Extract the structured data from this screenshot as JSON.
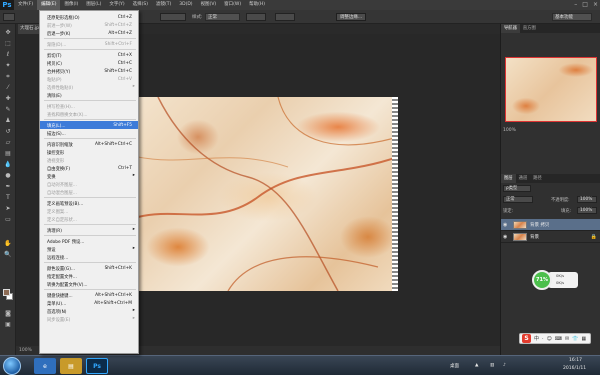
{
  "menubar": {
    "logo": "Ps",
    "items": [
      "文件(F)",
      "编辑(E)",
      "图像(I)",
      "图层(L)",
      "文字(Y)",
      "选择(S)",
      "滤镜(T)",
      "3D(D)",
      "视图(V)",
      "窗口(W)",
      "帮助(H)"
    ],
    "active_index": 1,
    "window_controls": [
      "–",
      "□",
      "×"
    ]
  },
  "options": {
    "style_label": "样式:",
    "style_value": "正常",
    "refine_edge": "调整边缘...",
    "workspace": "基本功能"
  },
  "document": {
    "tab_label": "大理石.jpg"
  },
  "status": {
    "zoom": "100%"
  },
  "edit_menu": {
    "items": [
      {
        "label": "还原矩形选框(O)",
        "shortcut": "Ctrl+Z",
        "state": "normal"
      },
      {
        "label": "前进一步(W)",
        "shortcut": "Shift+Ctrl+Z",
        "state": "disabled"
      },
      {
        "label": "后退一步(K)",
        "shortcut": "Alt+Ctrl+Z",
        "state": "normal"
      },
      {
        "sep": true
      },
      {
        "label": "渐隐(D)...",
        "shortcut": "Shift+Ctrl+F",
        "state": "disabled"
      },
      {
        "sep": true
      },
      {
        "label": "剪切(T)",
        "shortcut": "Ctrl+X",
        "state": "normal"
      },
      {
        "label": "拷贝(C)",
        "shortcut": "Ctrl+C",
        "state": "normal"
      },
      {
        "label": "合并拷贝(Y)",
        "shortcut": "Shift+Ctrl+C",
        "state": "normal"
      },
      {
        "label": "粘贴(P)",
        "shortcut": "Ctrl+V",
        "state": "disabled"
      },
      {
        "label": "选择性粘贴(I)",
        "shortcut": "",
        "state": "disabled",
        "submenu": true
      },
      {
        "label": "清除(E)",
        "shortcut": "",
        "state": "normal"
      },
      {
        "sep": true
      },
      {
        "label": "拼写检查(H)...",
        "shortcut": "",
        "state": "disabled"
      },
      {
        "label": "查找和替换文本(X)...",
        "shortcut": "",
        "state": "disabled"
      },
      {
        "sep": true
      },
      {
        "label": "填充(L)...",
        "shortcut": "Shift+F5",
        "state": "highlight"
      },
      {
        "label": "描边(S)...",
        "shortcut": "",
        "state": "normal"
      },
      {
        "sep": true
      },
      {
        "label": "内容识别缩放",
        "shortcut": "Alt+Shift+Ctrl+C",
        "state": "normal"
      },
      {
        "label": "操控变形",
        "shortcut": "",
        "state": "normal"
      },
      {
        "label": "透视变形",
        "shortcut": "",
        "state": "disabled"
      },
      {
        "label": "自由变换(F)",
        "shortcut": "Ctrl+T",
        "state": "normal"
      },
      {
        "label": "变换",
        "shortcut": "",
        "state": "normal",
        "submenu": true
      },
      {
        "label": "自动对齐图层...",
        "shortcut": "",
        "state": "disabled"
      },
      {
        "label": "自动混合图层...",
        "shortcut": "",
        "state": "disabled"
      },
      {
        "sep": true
      },
      {
        "label": "定义画笔预设(B)...",
        "shortcut": "",
        "state": "normal"
      },
      {
        "label": "定义图案...",
        "shortcut": "",
        "state": "disabled"
      },
      {
        "label": "定义自定形状...",
        "shortcut": "",
        "state": "disabled"
      },
      {
        "sep": true
      },
      {
        "label": "清理(R)",
        "shortcut": "",
        "state": "normal",
        "submenu": true
      },
      {
        "sep": true
      },
      {
        "label": "Adobe PDF 预设...",
        "shortcut": "",
        "state": "normal"
      },
      {
        "label": "预设",
        "shortcut": "",
        "state": "normal",
        "submenu": true
      },
      {
        "label": "远程连接...",
        "shortcut": "",
        "state": "normal"
      },
      {
        "sep": true
      },
      {
        "label": "颜色设置(G)...",
        "shortcut": "Shift+Ctrl+K",
        "state": "normal"
      },
      {
        "label": "指定配置文件...",
        "shortcut": "",
        "state": "normal"
      },
      {
        "label": "转换为配置文件(V)...",
        "shortcut": "",
        "state": "normal"
      },
      {
        "sep": true
      },
      {
        "label": "键盘快捷键...",
        "shortcut": "Alt+Shift+Ctrl+K",
        "state": "normal"
      },
      {
        "label": "菜单(U)...",
        "shortcut": "Alt+Shift+Ctrl+M",
        "state": "normal"
      },
      {
        "label": "首选项(N)",
        "shortcut": "",
        "state": "normal",
        "submenu": true
      },
      {
        "label": "同步设置(E)",
        "shortcut": "",
        "state": "disabled",
        "submenu": true
      }
    ]
  },
  "panels": {
    "top_tabs": [
      "导航器",
      "直方图"
    ],
    "nav_zoom": "100%",
    "layer_tabs": [
      "图层",
      "通道",
      "路径"
    ],
    "kind_label": "ρ类型",
    "blend_mode": "正常",
    "opacity_label": "不透明度:",
    "opacity_value": "100%",
    "lock_label": "锁定:",
    "fill_label": "填充:",
    "fill_value": "100%",
    "layers": [
      {
        "name": "背景 拷贝",
        "selected": true,
        "locked": false
      },
      {
        "name": "背景",
        "selected": false,
        "locked": true
      }
    ]
  },
  "widgets": {
    "speed_percent": "71%",
    "speed_up": "0K/s",
    "speed_down": "0K/s",
    "ime_items": [
      "S",
      "中",
      "·",
      "☺",
      "⌨",
      "✉",
      "👕",
      "▦"
    ]
  },
  "taskbar": {
    "tray_label": "桌面",
    "time": "16:17",
    "date": "2016/1/11"
  },
  "colors": {
    "highlight": "#3d7bd9",
    "speed_green": "#4cbf4c",
    "ime_red": "#e23b2d"
  }
}
